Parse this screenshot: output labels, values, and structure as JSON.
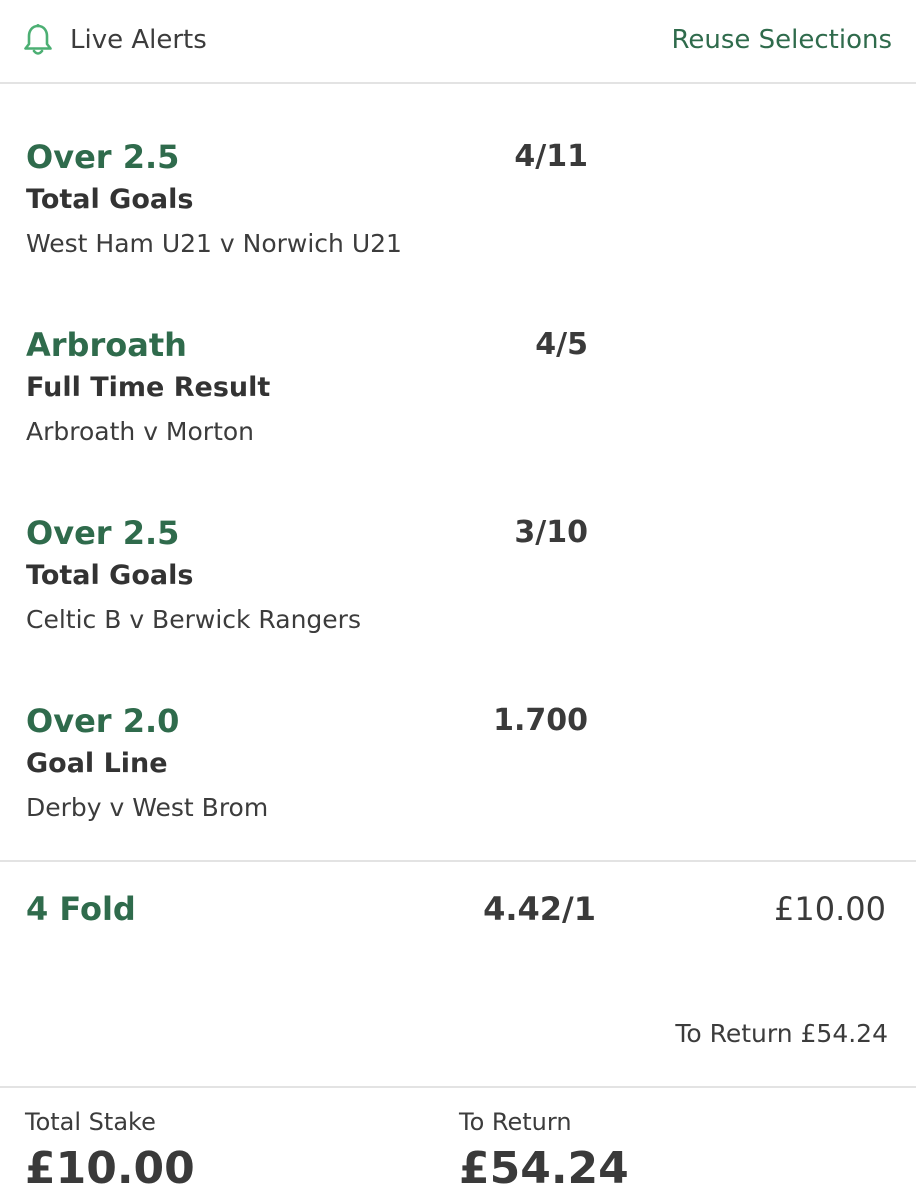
{
  "header": {
    "alerts_icon": "bell-icon",
    "alerts_label": "Live Alerts",
    "reuse_label": "Reuse Selections"
  },
  "selections": [
    {
      "name": "Over 2.5",
      "odds": "4/11",
      "market": "Total Goals",
      "event": "West Ham U21 v Norwich U21"
    },
    {
      "name": "Arbroath",
      "odds": "4/5",
      "market": "Full Time Result",
      "event": "Arbroath v Morton"
    },
    {
      "name": "Over 2.5",
      "odds": "3/10",
      "market": "Total Goals",
      "event": "Celtic B v Berwick Rangers"
    },
    {
      "name": "Over 2.0",
      "odds": "1.700",
      "market": "Goal Line",
      "event": "Derby v West Brom"
    }
  ],
  "fold": {
    "name": "4 Fold",
    "odds": "4.42/1",
    "stake": "£10.00",
    "to_return": "To Return £54.24"
  },
  "totals": {
    "stake_label": "Total Stake",
    "stake_value": "£10.00",
    "return_label": "To Return",
    "return_value": "£54.24"
  },
  "colors": {
    "accent_green": "#2f6b4c",
    "bell_green": "#4caf73",
    "text": "#3a3a3a",
    "divider": "#e3e3e3"
  }
}
